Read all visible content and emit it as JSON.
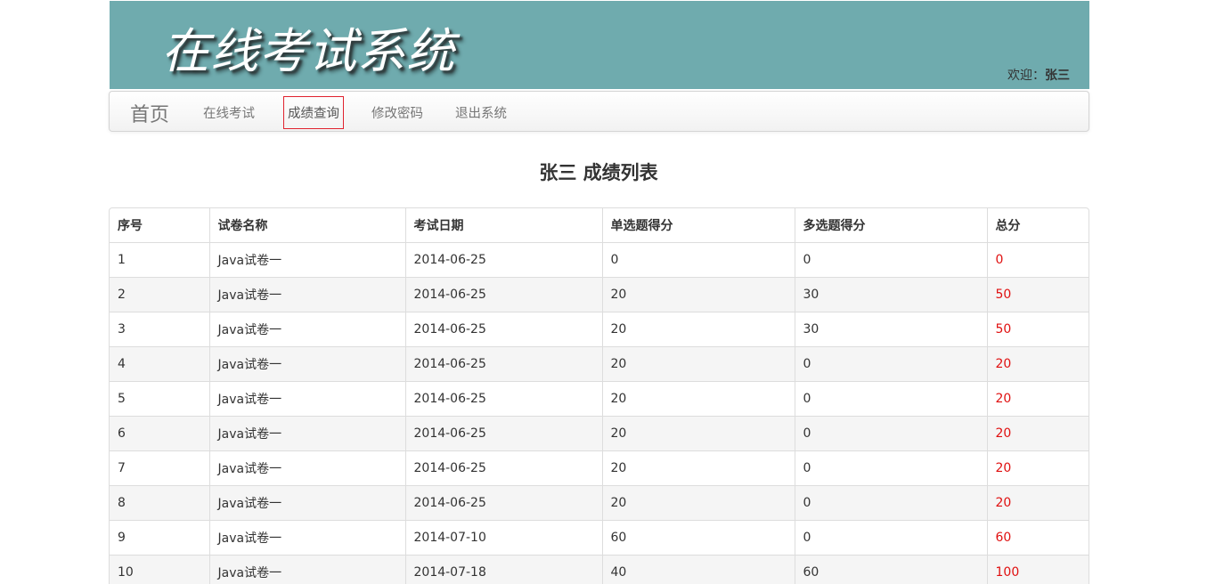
{
  "header": {
    "title": "在线考试系统",
    "welcome_label": "欢迎：",
    "user_name": "张三"
  },
  "nav": {
    "brand": "首页",
    "items": [
      {
        "label": "在线考试",
        "active": false
      },
      {
        "label": "成绩查询",
        "active": true
      },
      {
        "label": "修改密码",
        "active": false
      },
      {
        "label": "退出系统",
        "active": false
      }
    ]
  },
  "page_title": "张三 成绩列表",
  "table": {
    "columns": [
      "序号",
      "试卷名称",
      "考试日期",
      "单选题得分",
      "多选题得分",
      "总分"
    ],
    "rows": [
      [
        "1",
        "Java试卷一",
        "2014-06-25",
        "0",
        "0",
        "0"
      ],
      [
        "2",
        "Java试卷一",
        "2014-06-25",
        "20",
        "30",
        "50"
      ],
      [
        "3",
        "Java试卷一",
        "2014-06-25",
        "20",
        "30",
        "50"
      ],
      [
        "4",
        "Java试卷一",
        "2014-06-25",
        "20",
        "0",
        "20"
      ],
      [
        "5",
        "Java试卷一",
        "2014-06-25",
        "20",
        "0",
        "20"
      ],
      [
        "6",
        "Java试卷一",
        "2014-06-25",
        "20",
        "0",
        "20"
      ],
      [
        "7",
        "Java试卷一",
        "2014-06-25",
        "20",
        "0",
        "20"
      ],
      [
        "8",
        "Java试卷一",
        "2014-06-25",
        "20",
        "0",
        "20"
      ],
      [
        "9",
        "Java试卷一",
        "2014-07-10",
        "60",
        "0",
        "60"
      ],
      [
        "10",
        "Java试卷一",
        "2014-07-18",
        "40",
        "60",
        "100"
      ]
    ]
  },
  "colors": {
    "banner_bg": "#6fabae",
    "total_score": "#e01010",
    "active_nav_border": "#e0232f"
  }
}
